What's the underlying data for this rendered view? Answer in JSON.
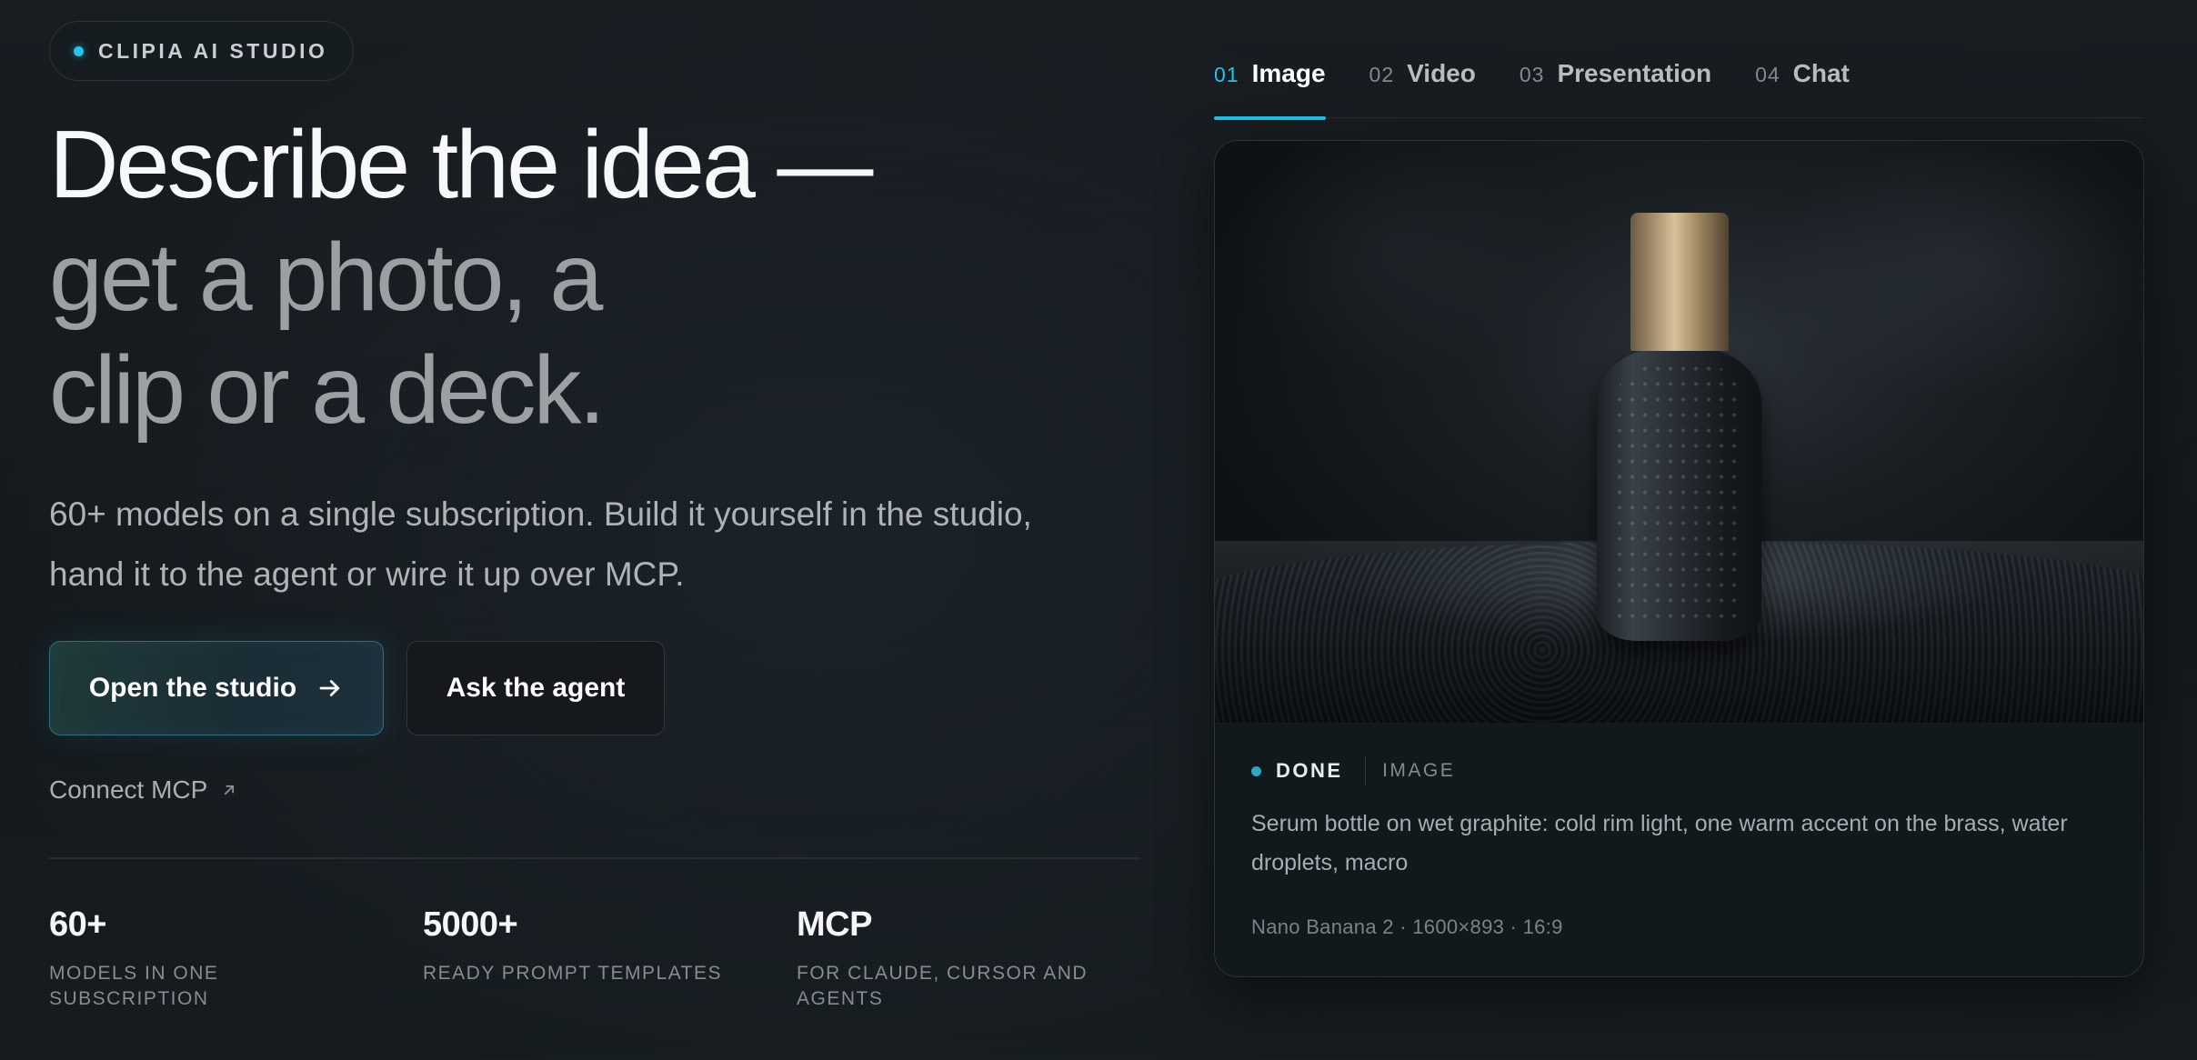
{
  "badge": {
    "text": "CLIPIA AI STUDIO"
  },
  "hero": {
    "line1": "Describe the idea —",
    "line2": "get a photo, a",
    "line3": "clip or a deck.",
    "subtitle": "60+ models on a single subscription. Build it yourself in the studio, hand it to the agent or wire it up over MCP."
  },
  "actions": {
    "primary_label": "Open the studio",
    "primary_icon": "arrow-right-icon",
    "secondary_label": "Ask the agent",
    "link_label": "Connect MCP",
    "link_icon": "arrow-up-right-icon"
  },
  "stats": [
    {
      "value": "60+",
      "label": "MODELS IN ONE SUBSCRIPTION"
    },
    {
      "value": "5000+",
      "label": "READY PROMPT TEMPLATES"
    },
    {
      "value": "MCP",
      "label": "FOR CLAUDE, CURSOR AND AGENTS"
    }
  ],
  "tabs": [
    {
      "num": "01",
      "label": "Image",
      "active": true
    },
    {
      "num": "02",
      "label": "Video",
      "active": false
    },
    {
      "num": "03",
      "label": "Presentation",
      "active": false
    },
    {
      "num": "04",
      "label": "Chat",
      "active": false
    }
  ],
  "card": {
    "status": "DONE",
    "type": "IMAGE",
    "prompt": "Serum bottle on wet graphite: cold rim light, one warm accent on the brass, water droplets, macro",
    "meta": "Nano Banana 2 · 1600×893 · 16:9"
  },
  "colors": {
    "accent": "#1ec2ea",
    "background": "#12171b",
    "status_dot": "#2aa6c6"
  }
}
